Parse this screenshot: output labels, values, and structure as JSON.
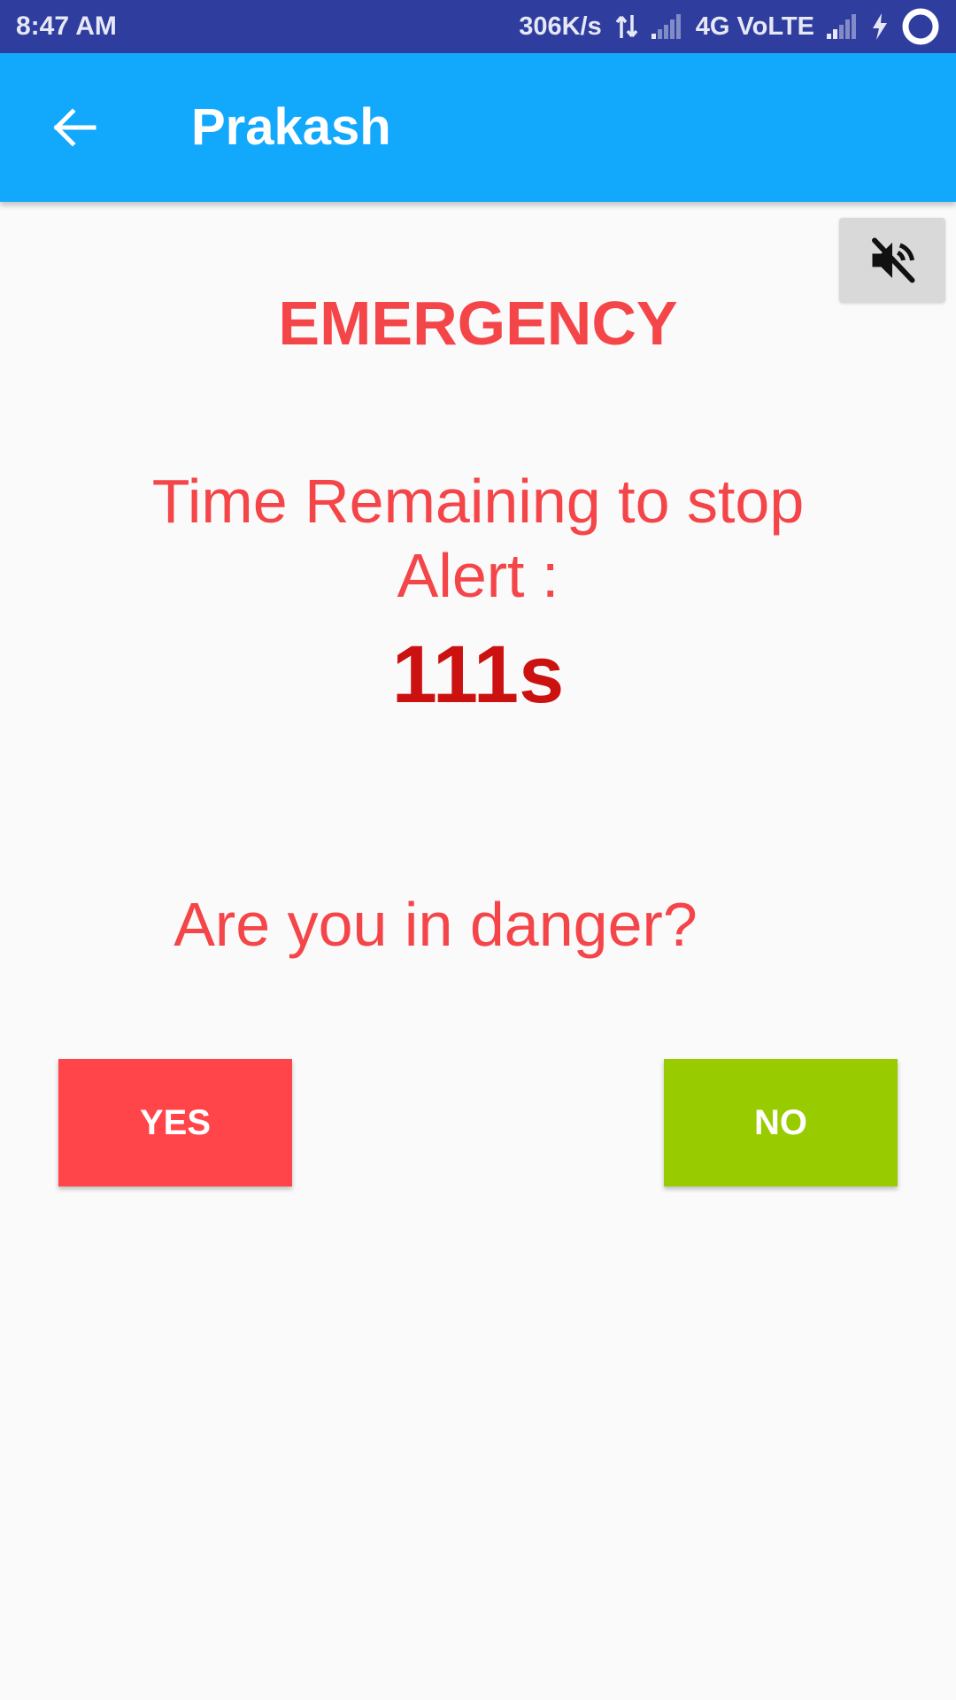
{
  "status_bar": {
    "time": "8:47 AM",
    "network_speed": "306K/s",
    "network_label": "4G VoLTE",
    "icons": [
      "data-transfer-icon",
      "signal-icon",
      "signal-icon",
      "charging-icon",
      "battery-ring-icon"
    ]
  },
  "app_bar": {
    "title": "Prakash",
    "back_icon": "arrow-left-icon",
    "color": "#12a8fb"
  },
  "mute_button": {
    "icon": "volume-off-icon"
  },
  "content": {
    "heading": "EMERGENCY",
    "time_label": "Time Remaining to stop Alert :",
    "countdown": "111s",
    "question": "Are you in danger?"
  },
  "actions": {
    "yes_label": "YES",
    "no_label": "NO",
    "yes_color": "#ff4549",
    "no_color": "#99cc00"
  }
}
